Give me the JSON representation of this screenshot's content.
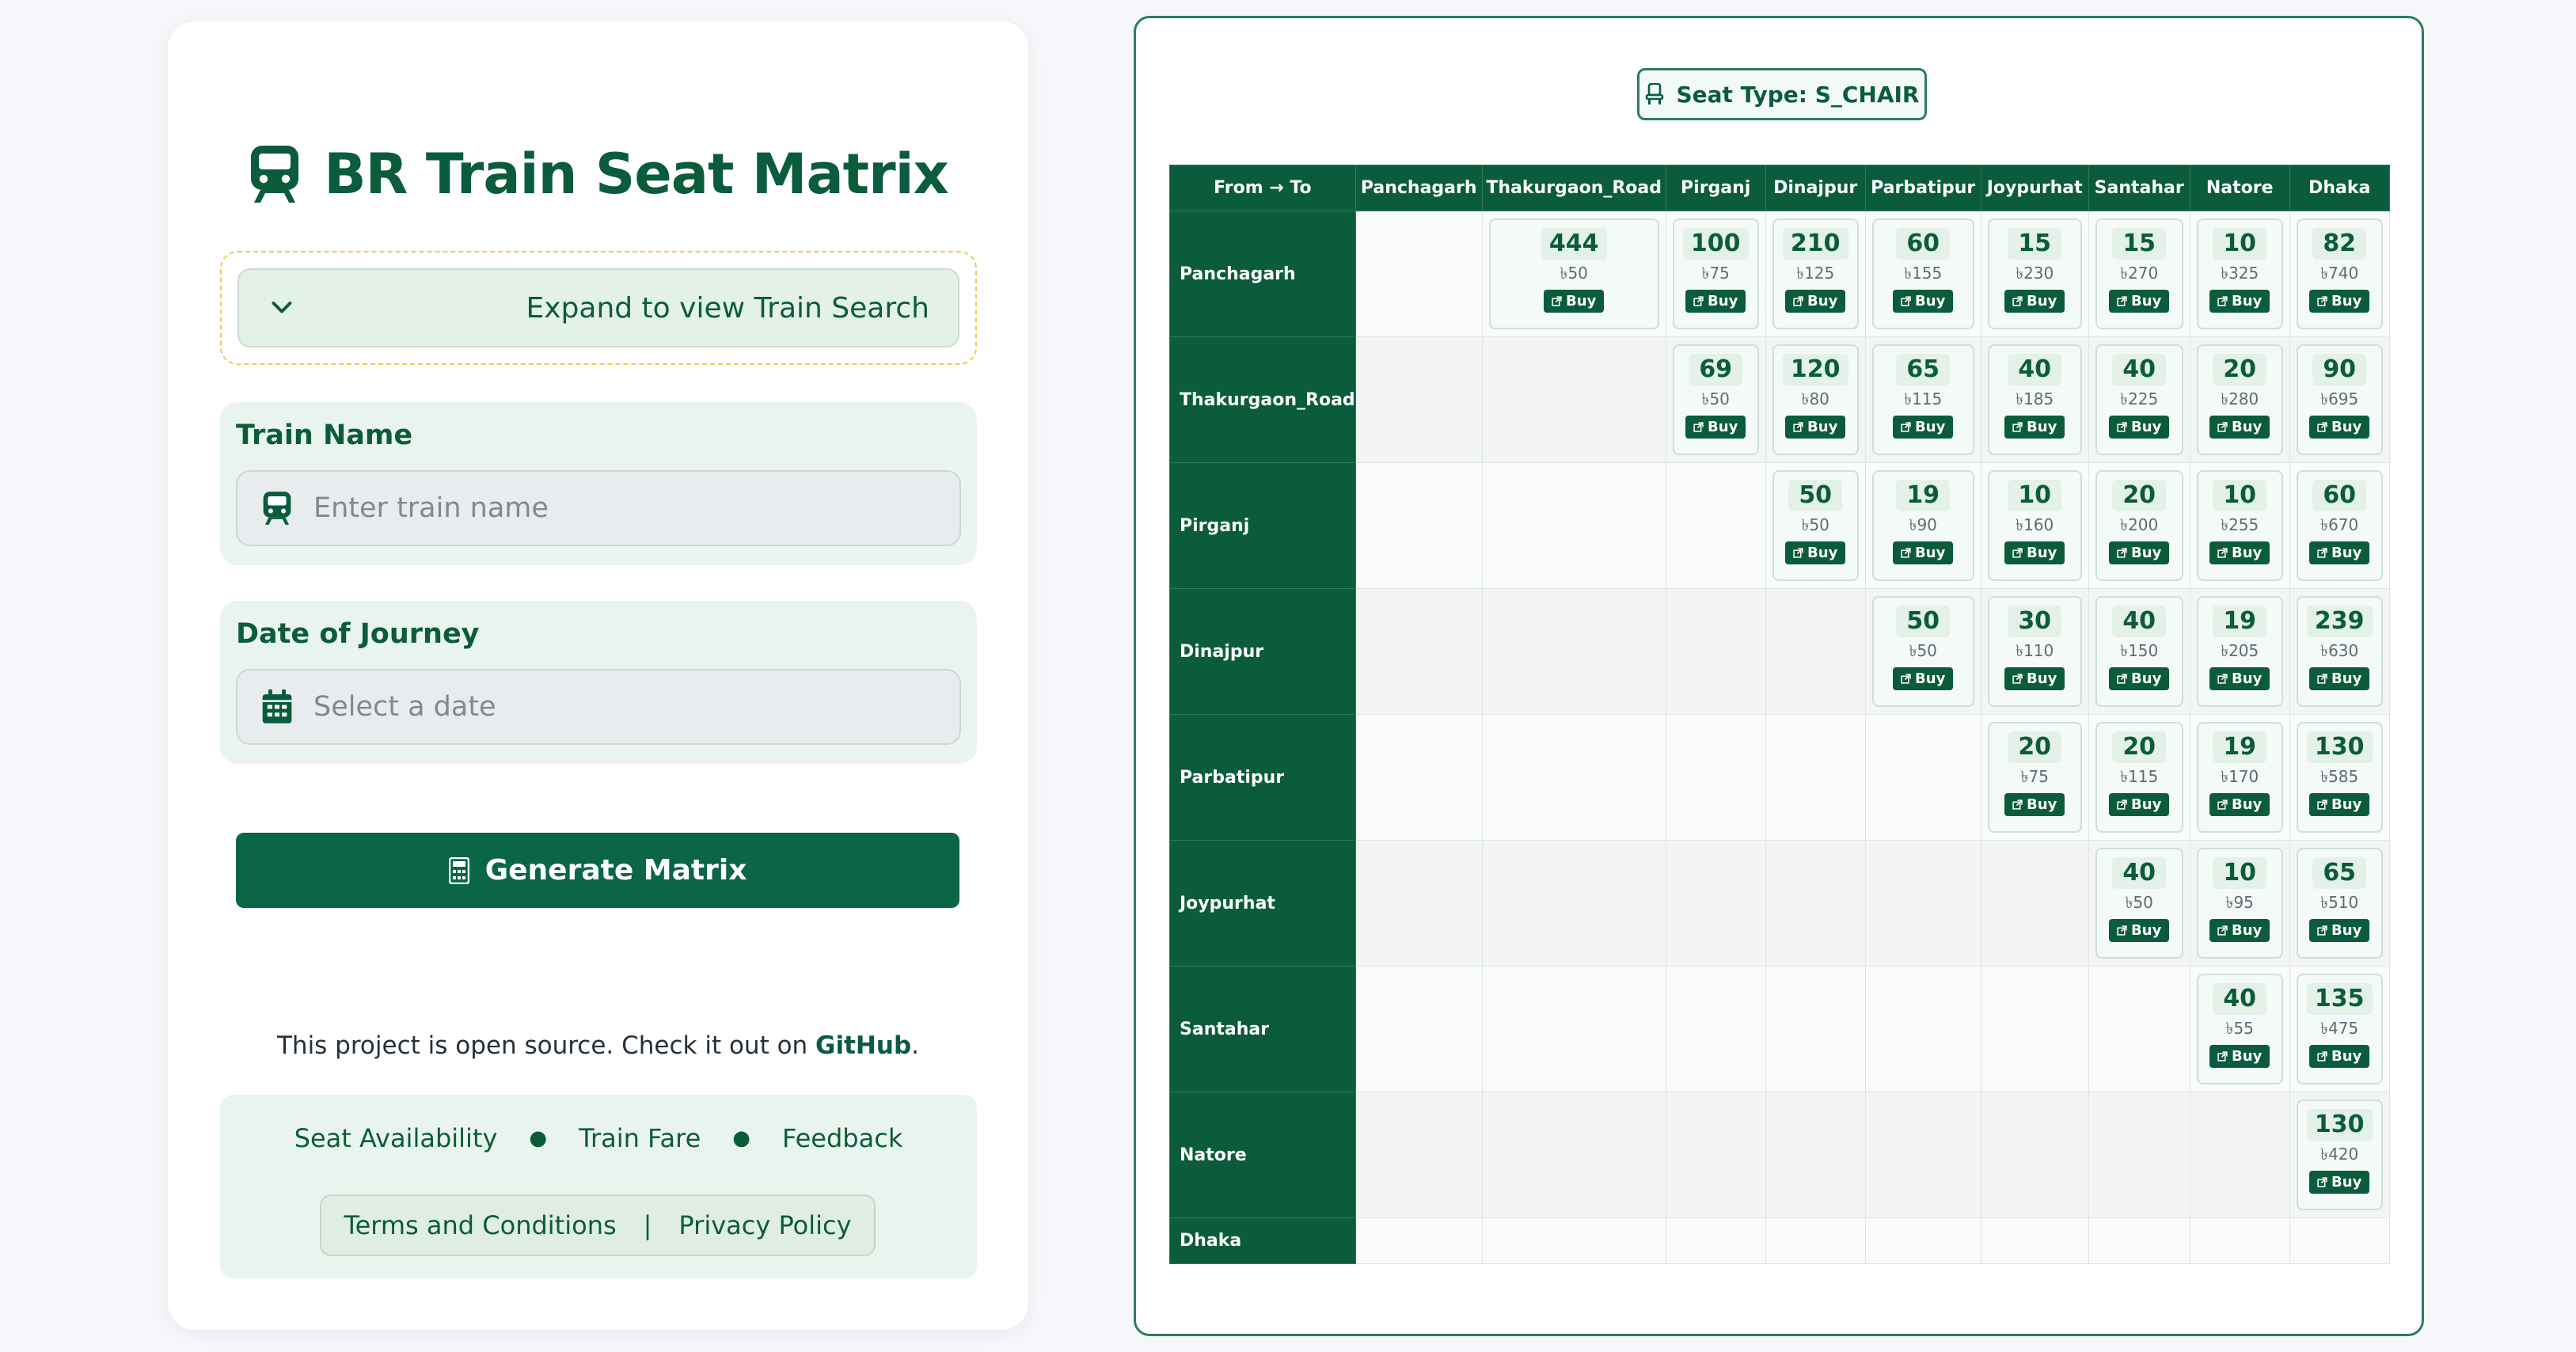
{
  "app": {
    "title": "BR Train Seat Matrix"
  },
  "search": {
    "expand_label": "Expand to view Train Search",
    "train_name_label": "Train Name",
    "train_name_placeholder": "Enter train name",
    "date_label": "Date of Journey",
    "date_placeholder": "Select a date",
    "generate_label": "Generate Matrix"
  },
  "footer": {
    "oss_text": "This project is open source. Check it out on ",
    "oss_link": "GitHub",
    "oss_suffix": ".",
    "links": [
      "Seat Availability",
      "Train Fare",
      "Feedback"
    ],
    "terms": "Terms and Conditions",
    "separator": "|",
    "privacy": "Privacy Policy"
  },
  "matrix": {
    "seat_type": "Seat Type: S_CHAIR",
    "corner_header": "From → To",
    "buy_label": "Buy",
    "currency": "৳",
    "columns": [
      "Panchagarh",
      "Thakurgaon_Road",
      "Pirganj",
      "Dinajpur",
      "Parbatipur",
      "Joypurhat",
      "Santahar",
      "Natore",
      "Dhaka"
    ],
    "rows": [
      {
        "from": "Panchagarh",
        "cells": [
          null,
          {
            "seats": 444,
            "fare": 50
          },
          {
            "seats": 100,
            "fare": 75
          },
          {
            "seats": 210,
            "fare": 125
          },
          {
            "seats": 60,
            "fare": 155
          },
          {
            "seats": 15,
            "fare": 230
          },
          {
            "seats": 15,
            "fare": 270
          },
          {
            "seats": 10,
            "fare": 325
          },
          {
            "seats": 82,
            "fare": 740
          }
        ]
      },
      {
        "from": "Thakurgaon_Road",
        "cells": [
          null,
          null,
          {
            "seats": 69,
            "fare": 50
          },
          {
            "seats": 120,
            "fare": 80
          },
          {
            "seats": 65,
            "fare": 115
          },
          {
            "seats": 40,
            "fare": 185
          },
          {
            "seats": 40,
            "fare": 225
          },
          {
            "seats": 20,
            "fare": 280
          },
          {
            "seats": 90,
            "fare": 695
          }
        ]
      },
      {
        "from": "Pirganj",
        "cells": [
          null,
          null,
          null,
          {
            "seats": 50,
            "fare": 50
          },
          {
            "seats": 19,
            "fare": 90
          },
          {
            "seats": 10,
            "fare": 160
          },
          {
            "seats": 20,
            "fare": 200
          },
          {
            "seats": 10,
            "fare": 255
          },
          {
            "seats": 60,
            "fare": 670
          }
        ]
      },
      {
        "from": "Dinajpur",
        "cells": [
          null,
          null,
          null,
          null,
          {
            "seats": 50,
            "fare": 50
          },
          {
            "seats": 30,
            "fare": 110
          },
          {
            "seats": 40,
            "fare": 150
          },
          {
            "seats": 19,
            "fare": 205
          },
          {
            "seats": 239,
            "fare": 630
          }
        ]
      },
      {
        "from": "Parbatipur",
        "cells": [
          null,
          null,
          null,
          null,
          null,
          {
            "seats": 20,
            "fare": 75
          },
          {
            "seats": 20,
            "fare": 115
          },
          {
            "seats": 19,
            "fare": 170
          },
          {
            "seats": 130,
            "fare": 585
          }
        ]
      },
      {
        "from": "Joypurhat",
        "cells": [
          null,
          null,
          null,
          null,
          null,
          null,
          {
            "seats": 40,
            "fare": 50
          },
          {
            "seats": 10,
            "fare": 95
          },
          {
            "seats": 65,
            "fare": 510
          }
        ]
      },
      {
        "from": "Santahar",
        "cells": [
          null,
          null,
          null,
          null,
          null,
          null,
          null,
          {
            "seats": 40,
            "fare": 55
          },
          {
            "seats": 135,
            "fare": 475
          }
        ]
      },
      {
        "from": "Natore",
        "cells": [
          null,
          null,
          null,
          null,
          null,
          null,
          null,
          null,
          {
            "seats": 130,
            "fare": 420
          }
        ]
      },
      {
        "from": "Dhaka",
        "cells": [
          null,
          null,
          null,
          null,
          null,
          null,
          null,
          null,
          null
        ]
      }
    ]
  }
}
